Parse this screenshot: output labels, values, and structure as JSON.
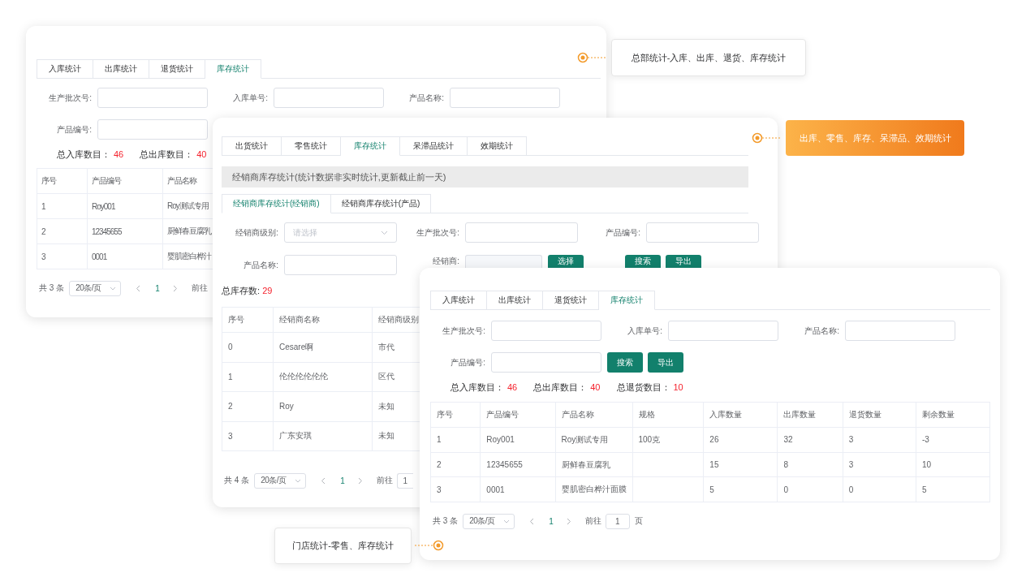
{
  "hq_panel": {
    "tabs": [
      {
        "label": "入库统计",
        "selected": false
      },
      {
        "label": "出库统计",
        "selected": false
      },
      {
        "label": "退货统计",
        "selected": false
      },
      {
        "label": "库存统计",
        "selected": true
      }
    ],
    "filters": [
      {
        "label": "生产批次号:"
      },
      {
        "label": "入库单号:"
      },
      {
        "label": "产品名称:"
      },
      {
        "label": "产品编号:"
      }
    ],
    "totals": [
      {
        "label": "总入库数目：",
        "value": "46"
      },
      {
        "label": "总出库数目：",
        "value": "40"
      }
    ],
    "table": {
      "columns": [
        "序号",
        "产品编号",
        "产品名称"
      ],
      "rows": [
        [
          "1",
          "Roy001",
          "Roy测试专用"
        ],
        [
          "2",
          "12345655",
          "厨鲜春豆腐乳"
        ],
        [
          "3",
          "0001",
          "婴肌密白桦汁"
        ]
      ]
    },
    "pagination": {
      "total": "共 3 条",
      "page_size": "20条/页",
      "pages": [
        {
          "label": "1",
          "selected": true
        }
      ],
      "goto": "前往"
    }
  },
  "dealer_panel": {
    "tabs": [
      {
        "label": "出货统计",
        "selected": false
      },
      {
        "label": "零售统计",
        "selected": false
      },
      {
        "label": "库存统计",
        "selected": true
      },
      {
        "label": "呆滞品统计",
        "selected": false
      },
      {
        "label": "效期统计",
        "selected": false
      }
    ],
    "banner": "经销商库存统计(统计数据非实时统计,更新截止前一天)",
    "subtabs": [
      {
        "label": "经销商库存统计(经销商)",
        "selected": true
      },
      {
        "label": "经销商库存统计(产品)",
        "selected": false
      }
    ],
    "filters": [
      {
        "label": "经销商级别:",
        "kind": "select",
        "placeholder": "请选择"
      },
      {
        "label": "生产批次号:",
        "kind": "text"
      },
      {
        "label": "产品编号:",
        "kind": "text"
      },
      {
        "label": "产品名称:",
        "kind": "text"
      },
      {
        "label": "经销商:",
        "kind": "picker",
        "button": "选择"
      }
    ],
    "actions": [
      "搜索",
      "导出"
    ],
    "totals": [
      {
        "label": "总库存数: ",
        "value": "29"
      }
    ],
    "table": {
      "columns": [
        "序号",
        "经销商名称",
        "经销商级别"
      ],
      "rows": [
        [
          "0",
          "Cesare啊",
          "市代"
        ],
        [
          "1",
          "伦伦伦伦伦伦",
          "区代"
        ],
        [
          "2",
          "Roy",
          "未知"
        ],
        [
          "3",
          "广东安琪",
          "未知"
        ]
      ]
    },
    "pagination": {
      "total": "共 4 条",
      "page_size": "20条/页",
      "pages": [
        {
          "label": "1",
          "selected": true
        }
      ],
      "goto": "前往",
      "goto_value": "1"
    }
  },
  "store_panel": {
    "tabs": [
      {
        "label": "入库统计",
        "selected": false
      },
      {
        "label": "出库统计",
        "selected": false
      },
      {
        "label": "退货统计",
        "selected": false
      },
      {
        "label": "库存统计",
        "selected": true
      }
    ],
    "filters": [
      {
        "label": "生产批次号:"
      },
      {
        "label": "入库单号:"
      },
      {
        "label": "产品名称:"
      },
      {
        "label": "产品编号:"
      }
    ],
    "actions": [
      "搜索",
      "导出"
    ],
    "totals": [
      {
        "label": "总入库数目：",
        "value": "46"
      },
      {
        "label": "总出库数目：",
        "value": "40"
      },
      {
        "label": "总退货数目：",
        "value": "10"
      }
    ],
    "table": {
      "columns": [
        "序号",
        "产品编号",
        "产品名称",
        "规格",
        "入库数量",
        "出库数量",
        "退货数量",
        "剩余数量"
      ],
      "rows": [
        [
          "1",
          "Roy001",
          "Roy测试专用",
          "100克",
          "26",
          "32",
          "3",
          "-3"
        ],
        [
          "2",
          "12345655",
          "厨鲜春豆腐乳",
          "",
          "15",
          "8",
          "3",
          "10"
        ],
        [
          "3",
          "0001",
          "婴肌密白桦汁面膜",
          "",
          "5",
          "0",
          "0",
          "5"
        ]
      ]
    },
    "pagination": {
      "total": "共 3 条",
      "page_size": "20条/页",
      "pages": [
        {
          "label": "1",
          "selected": true
        }
      ],
      "goto": "前往",
      "goto_value": "1",
      "suffix": "页"
    }
  },
  "callouts": [
    {
      "text": "总部统计-入库、出库、退货、库存统计",
      "kind": "plain"
    },
    {
      "text": "出库、零售、库存、呆滞品、效期统计",
      "kind": "highlight"
    },
    {
      "text": "门店统计-零售、库存统计",
      "kind": "plain"
    }
  ]
}
